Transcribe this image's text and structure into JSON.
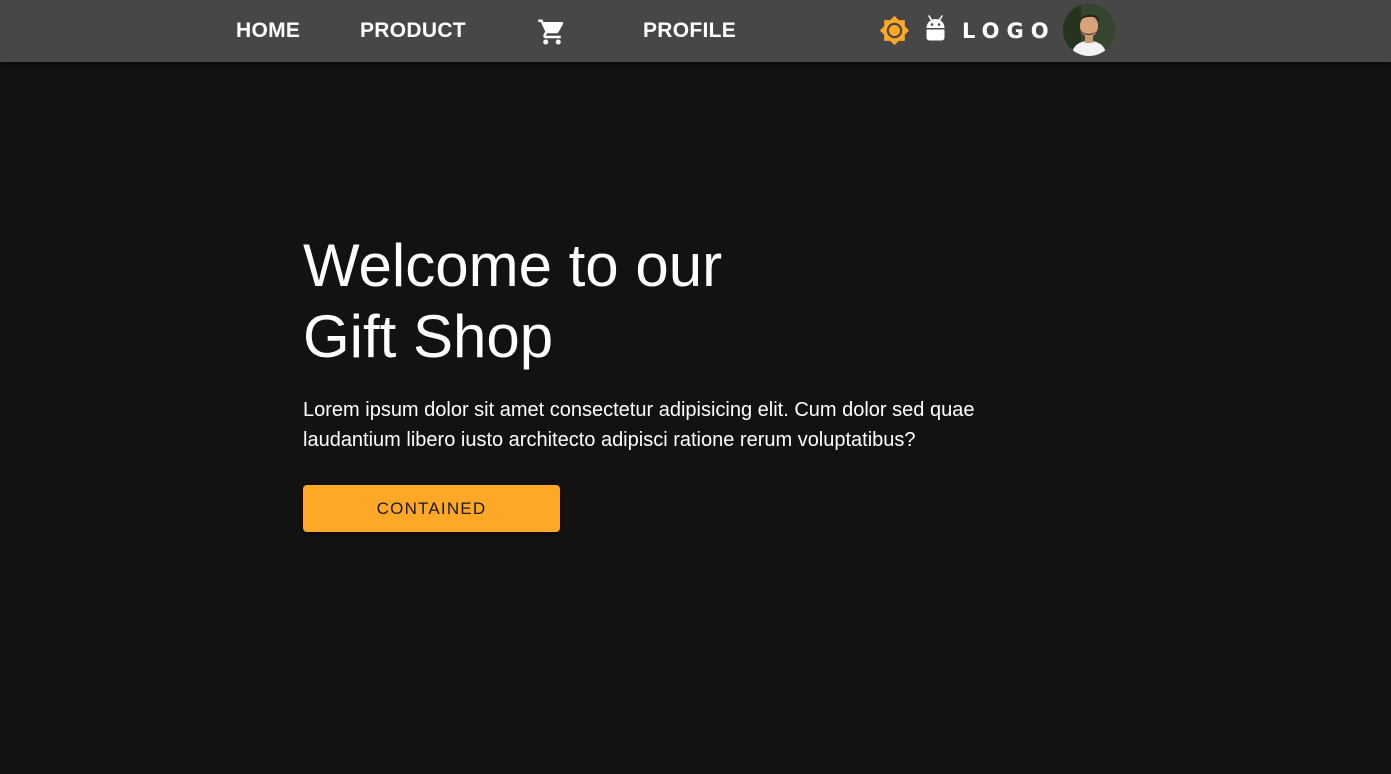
{
  "header": {
    "nav": {
      "home": "HOME",
      "product": "PRODUCT",
      "profile": "PROFILE"
    },
    "icons": {
      "cart": "cart-icon",
      "theme": "sun-icon",
      "android": "android-icon"
    },
    "logo": "LOGO",
    "colors": {
      "bar": "#474747",
      "accent": "#ffa726"
    }
  },
  "hero": {
    "title_line1": "Welcome to our",
    "title_line2": "Gift Shop",
    "body": "Lorem ipsum dolor sit amet consectetur adipisicing elit. Cum dolor sed quae laudantium libero iusto architecto adipisci ratione rerum voluptatibus?",
    "button_label": "CONTAINED",
    "colors": {
      "background": "#121212",
      "button": "#ffa726"
    }
  }
}
